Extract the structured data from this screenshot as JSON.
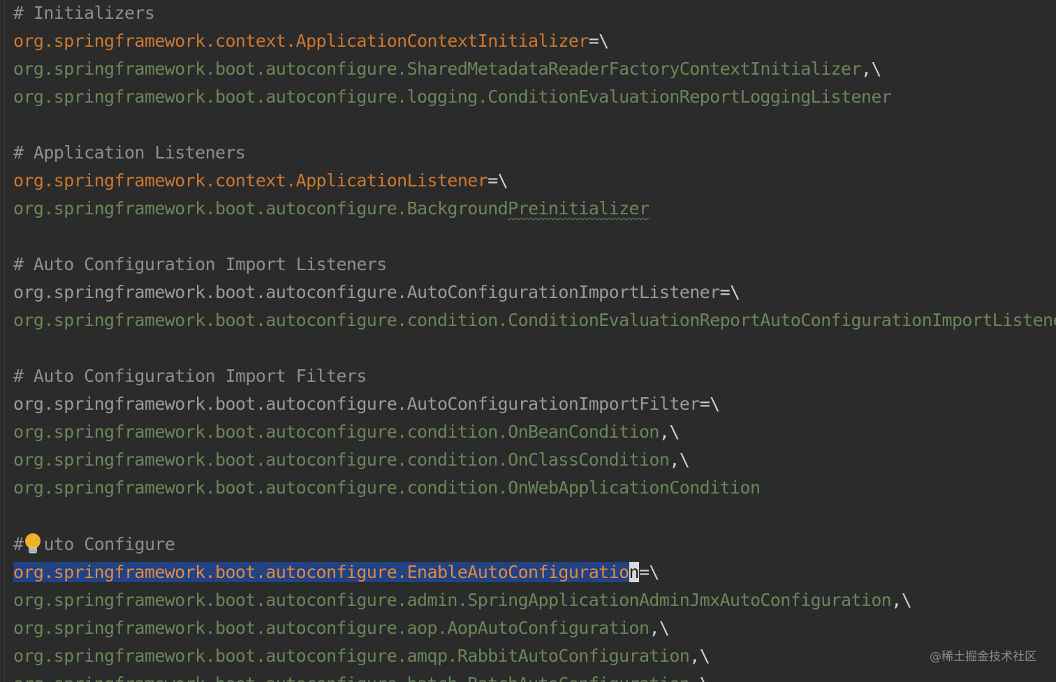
{
  "editor": {
    "lines": [
      {
        "type": "comment",
        "text": "# Initializers"
      },
      {
        "type": "key",
        "text": "org.springframework.context.ApplicationContextInitializer",
        "suffix": "=\\"
      },
      {
        "type": "val",
        "text": "org.springframework.boot.autoconfigure.SharedMetadataReaderFactoryContextInitializer",
        "suffix": ",\\"
      },
      {
        "type": "val",
        "text": "org.springframework.boot.autoconfigure.logging.ConditionEvaluationReportLoggingListener",
        "suffix": ""
      },
      {
        "type": "comment",
        "text": "# Application Listeners"
      },
      {
        "type": "key",
        "text": "org.springframework.context.ApplicationListener",
        "suffix": "=\\"
      },
      {
        "type": "val",
        "text": "org.springframework.boot.autoconfigure.Background",
        "extra": "Preinitializer",
        "suffix": ""
      },
      {
        "type": "comment",
        "text": "# Auto Configuration Import Listeners"
      },
      {
        "type": "dim",
        "text": "org.springframework.boot.autoconfigure.AutoConfigurationImportListener",
        "suffix": "=\\"
      },
      {
        "type": "val",
        "text": "org.springframework.boot.autoconfigure.condition.ConditionEvaluationReportAutoConfigurationImportListener",
        "suffix": ""
      },
      {
        "type": "comment",
        "text": "# Auto Configuration Import Filters"
      },
      {
        "type": "dim",
        "text": "org.springframework.boot.autoconfigure.AutoConfigurationImportFilter",
        "suffix": "=\\"
      },
      {
        "type": "val",
        "text": "org.springframework.boot.autoconfigure.condition.OnBeanCondition",
        "suffix": ",\\"
      },
      {
        "type": "val",
        "text": "org.springframework.boot.autoconfigure.condition.OnClassCondition",
        "suffix": ",\\"
      },
      {
        "type": "val",
        "text": "org.springframework.boot.autoconfigure.condition.OnWebApplicationCondition",
        "suffix": ""
      },
      {
        "type": "comment",
        "text_before": "#",
        "text_after": "uto Configure"
      },
      {
        "type": "key",
        "text": "org.springframework.boot.autoconfigure.EnableAutoConfiguratio",
        "caret_char": "n",
        "suffix": "=\\"
      },
      {
        "type": "val",
        "text": "org.springframework.boot.autoconfigure.admin.SpringApplicationAdminJmxAutoConfiguration",
        "suffix": ",\\"
      },
      {
        "type": "val",
        "text": "org.springframework.boot.autoconfigure.aop.AopAutoConfiguration",
        "suffix": ",\\"
      },
      {
        "type": "val",
        "text": "org.springframework.boot.autoconfigure.amqp.RabbitAutoConfiguration",
        "suffix": ",\\"
      },
      {
        "type": "val",
        "text": "org.springframework.boot.autoconfigure.batch.BatchAutoConfiguration",
        "suffix": ",\\"
      }
    ]
  },
  "watermark": "@稀土掘金技术社区",
  "icons": {
    "intention": "lightbulb-icon"
  },
  "colors": {
    "background": "#2b2b2b",
    "key": "#cc7832",
    "value": "#6a8759",
    "comment": "#8e8e8e",
    "selection": "#214283",
    "bulb": "#f2b125"
  }
}
